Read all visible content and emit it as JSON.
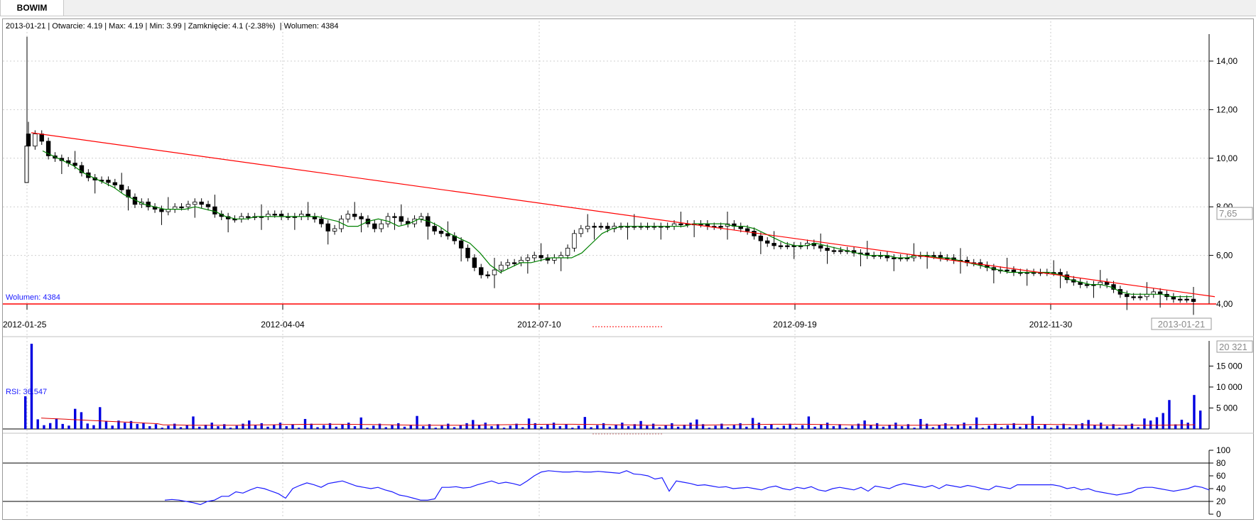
{
  "tab": {
    "label": "BOWIM"
  },
  "info": {
    "date": "2013-01-21",
    "open": "Otwarcie: 4.19",
    "max": "Max: 4.19",
    "min": "Min: 3.99",
    "close": "Zamknięcie: 4.1 (-2.38%)",
    "volume": "Wolumen: 4384"
  },
  "volume_panel": {
    "label": "Wolumen: 4384",
    "current_box": "20 321"
  },
  "rsi_panel": {
    "label": "RSI: 36.547"
  },
  "price_panel": {
    "current_box": "7,65",
    "last_date_box": "2013-01-21"
  },
  "chart_data": [
    {
      "type": "candlestick",
      "x_ticks": [
        "2012-01-25",
        "2012-04-04",
        "2012-07-10",
        "2012-09-19",
        "2012-11-30"
      ],
      "y_ticks": [
        "4,00",
        "6,00",
        "8,00",
        "10,00",
        "12,00",
        "14,00"
      ],
      "ylim": [
        4,
        15
      ],
      "colors": {
        "trendline": "#ff0000",
        "moving_average": "#008000",
        "candle": "#000000"
      },
      "close_path": [
        10.5,
        11.0,
        10.7,
        10.1,
        10.0,
        9.9,
        9.8,
        9.7,
        9.4,
        9.2,
        9.1,
        9.1,
        9.0,
        8.9,
        8.7,
        8.4,
        8.1,
        8.2,
        8.0,
        7.9,
        7.8,
        7.9,
        8.0,
        8.0,
        8.1,
        8.2,
        8.1,
        8.0,
        7.7,
        7.6,
        7.5,
        7.5,
        7.6,
        7.6,
        7.6,
        7.6,
        7.7,
        7.7,
        7.6,
        7.6,
        7.6,
        7.7,
        7.6,
        7.5,
        7.3,
        7.0,
        7.1,
        7.5,
        7.7,
        7.6,
        7.5,
        7.3,
        7.1,
        7.3,
        7.6,
        7.6,
        7.4,
        7.3,
        7.5,
        7.6,
        7.2,
        7.0,
        6.9,
        6.8,
        6.6,
        6.3,
        5.9,
        5.5,
        5.2,
        5.2,
        5.4,
        5.6,
        5.7,
        5.7,
        5.8,
        5.9,
        6.0,
        5.9,
        5.8,
        5.9,
        6.0,
        6.3,
        6.9,
        7.1,
        7.2,
        7.2,
        7.2,
        7.1,
        7.2,
        7.2,
        7.2,
        7.2,
        7.2,
        7.2,
        7.2,
        7.2,
        7.2,
        7.3,
        7.3,
        7.3,
        7.3,
        7.3,
        7.2,
        7.2,
        7.2,
        7.3,
        7.2,
        7.1,
        7.0,
        6.8,
        6.6,
        6.5,
        6.4,
        6.4,
        6.4,
        6.4,
        6.4,
        6.5,
        6.4,
        6.3,
        6.2,
        6.2,
        6.2,
        6.2,
        6.1,
        6.1,
        6.0,
        6.0,
        6.0,
        5.9,
        5.9,
        5.9,
        5.9,
        6.0,
        6.0,
        6.0,
        6.0,
        5.9,
        5.9,
        5.8,
        5.8,
        5.7,
        5.7,
        5.6,
        5.5,
        5.4,
        5.4,
        5.4,
        5.3,
        5.3,
        5.3,
        5.3,
        5.3,
        5.3,
        5.3,
        5.2,
        5.0,
        4.9,
        4.8,
        4.8,
        4.8,
        4.9,
        4.8,
        4.6,
        4.4,
        4.3,
        4.3,
        4.3,
        4.4,
        4.5,
        4.4,
        4.3,
        4.2,
        4.2,
        4.2,
        4.1
      ],
      "ma_path": [
        10.3,
        10.1,
        9.9,
        9.7,
        9.4,
        9.2,
        9.0,
        8.8,
        8.5,
        8.3,
        8.1,
        8.0,
        7.9,
        7.9,
        7.9,
        8.0,
        7.9,
        7.8,
        7.6,
        7.5,
        7.5,
        7.6,
        7.6,
        7.6,
        7.6,
        7.6,
        7.6,
        7.6,
        7.5,
        7.4,
        7.2,
        7.2,
        7.4,
        7.5,
        7.4,
        7.2,
        7.3,
        7.5,
        7.4,
        7.2,
        6.9,
        6.7,
        6.5,
        6.1,
        5.6,
        5.3,
        5.5,
        5.7,
        5.7,
        5.8,
        5.9,
        5.9,
        5.9,
        6.1,
        6.5,
        6.9,
        7.1,
        7.2,
        7.2,
        7.2,
        7.2,
        7.2,
        7.2,
        7.2,
        7.3,
        7.3,
        7.3,
        7.3,
        7.2,
        7.2,
        7.1,
        6.9,
        6.7,
        6.5,
        6.4,
        6.4,
        6.5,
        6.4,
        6.3,
        6.2,
        6.1,
        6.0,
        6.0,
        6.0,
        5.9,
        5.9,
        6.0,
        6.0,
        5.9,
        5.9,
        5.8,
        5.7,
        5.6,
        5.5,
        5.4,
        5.3,
        5.3,
        5.3,
        5.3,
        5.3,
        5.2,
        5.0,
        4.9,
        4.8,
        4.8,
        4.7,
        4.5,
        4.4,
        4.4,
        4.4,
        4.4,
        4.3,
        4.3,
        4.3
      ],
      "trendline": {
        "start": [
          "2012-01-25",
          11.05
        ],
        "end": [
          "2013-01-21",
          4.3
        ]
      },
      "support_level": 4.0
    },
    {
      "type": "bar",
      "series": "volume",
      "y_ticks": [
        "5 000",
        "10 000",
        "15 000"
      ],
      "ylim": [
        0,
        20321
      ],
      "colors": {
        "bar": "#0000e0",
        "average": "#e00000"
      },
      "spikes": [
        7800,
        20321,
        2300,
        900,
        1400,
        2500,
        1200,
        800,
        4800,
        4000,
        1300,
        900,
        5200,
        1900,
        800,
        2000,
        1500,
        1900,
        1200
      ],
      "tail_spikes": [
        2000,
        2800,
        3800,
        6900,
        1100,
        2200,
        1500,
        8100,
        4384
      ]
    },
    {
      "type": "line",
      "series": "RSI",
      "y_ticks": [
        "0",
        "20",
        "40",
        "60",
        "80",
        "100"
      ],
      "ylim": [
        0,
        100
      ],
      "levels": [
        20,
        80
      ],
      "colors": {
        "line": "#1a1aff",
        "levels": "#000000"
      },
      "values": [
        22,
        23,
        22,
        20,
        18,
        15,
        20,
        22,
        28,
        28,
        35,
        33,
        38,
        42,
        40,
        36,
        32,
        25,
        40,
        45,
        49,
        46,
        42,
        48,
        50,
        52,
        48,
        44,
        42,
        40,
        42,
        38,
        35,
        30,
        28,
        25,
        22,
        22,
        24,
        42,
        42,
        43,
        41,
        42,
        46,
        49,
        52,
        48,
        50,
        48,
        45,
        52,
        60,
        66,
        68,
        67,
        66,
        66,
        67,
        66,
        66,
        67,
        66,
        65,
        64,
        68,
        63,
        62,
        60,
        55,
        57,
        36,
        52,
        50,
        48,
        45,
        46,
        44,
        42,
        43,
        40,
        41,
        42,
        40,
        38,
        42,
        44,
        40,
        38,
        42,
        40,
        43,
        38,
        36,
        40,
        42,
        40,
        38,
        42,
        36,
        44,
        42,
        40,
        45,
        48,
        46,
        44,
        42,
        45,
        40,
        46,
        44,
        42,
        45,
        43,
        40,
        38,
        44,
        42,
        40,
        46,
        46,
        46,
        46,
        46,
        46,
        44,
        40,
        42,
        38,
        40,
        36,
        34,
        32,
        30,
        32,
        34,
        40,
        42,
        42,
        40,
        38,
        36,
        38,
        40,
        44,
        42,
        38
      ]
    }
  ]
}
